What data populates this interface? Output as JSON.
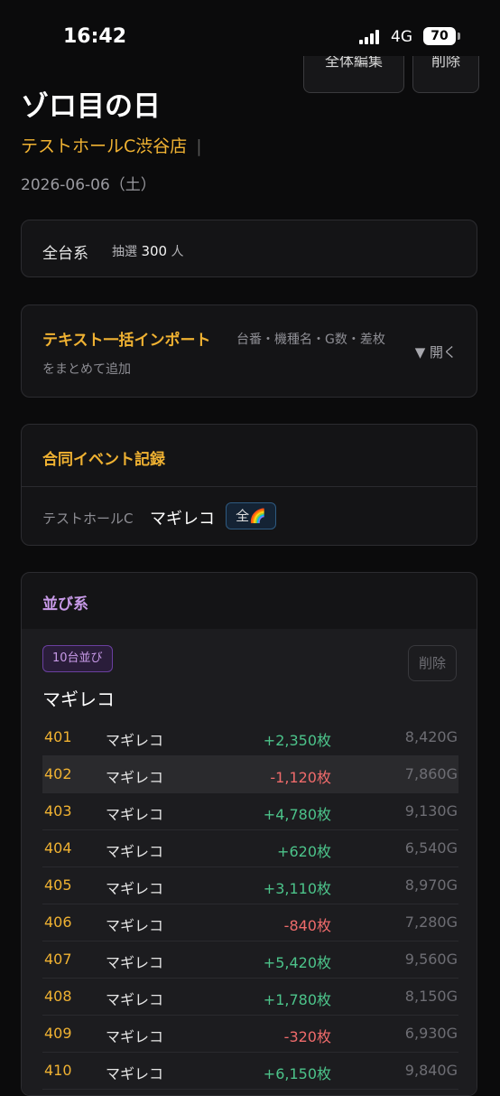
{
  "status": {
    "time": "16:42",
    "network": "4G",
    "battery": "70"
  },
  "top_actions": {
    "edit_label": "全体編集",
    "delete_label": "削除"
  },
  "event": {
    "title": "ゾロ目の日",
    "store": "テストホールC渋谷店",
    "separator": "|",
    "date": "2026-06-06（土）"
  },
  "lottery": {
    "type": "全台系",
    "prefix": "抽選",
    "count": "300",
    "unit": "人"
  },
  "import": {
    "title": "テキスト一括インポート",
    "desc1": "台番・機種名・G数・差枚",
    "desc2": "をまとめて追加",
    "toggle": "▼ 開く"
  },
  "joint": {
    "title": "合同イベント記録",
    "store": "テストホールC",
    "machine": "マギレコ",
    "badge": "全🌈"
  },
  "row_section": {
    "title": "並び系",
    "group": {
      "tag": "10台並び",
      "delete_label": "削除",
      "machine": "マギレコ",
      "rows": [
        {
          "num": "401",
          "machine": "マギレコ",
          "diff": "+2,350枚",
          "games": "8,420G",
          "sign": "pos"
        },
        {
          "num": "402",
          "machine": "マギレコ",
          "diff": "-1,120枚",
          "games": "7,860G",
          "sign": "neg"
        },
        {
          "num": "403",
          "machine": "マギレコ",
          "diff": "+4,780枚",
          "games": "9,130G",
          "sign": "pos"
        },
        {
          "num": "404",
          "machine": "マギレコ",
          "diff": "+620枚",
          "games": "6,540G",
          "sign": "pos"
        },
        {
          "num": "405",
          "machine": "マギレコ",
          "diff": "+3,110枚",
          "games": "8,970G",
          "sign": "pos"
        },
        {
          "num": "406",
          "machine": "マギレコ",
          "diff": "-840枚",
          "games": "7,280G",
          "sign": "neg"
        },
        {
          "num": "407",
          "machine": "マギレコ",
          "diff": "+5,420枚",
          "games": "9,560G",
          "sign": "pos"
        },
        {
          "num": "408",
          "machine": "マギレコ",
          "diff": "+1,780枚",
          "games": "8,150G",
          "sign": "pos"
        },
        {
          "num": "409",
          "machine": "マギレコ",
          "diff": "-320枚",
          "games": "6,930G",
          "sign": "neg"
        },
        {
          "num": "410",
          "machine": "マギレコ",
          "diff": "+6,150枚",
          "games": "9,840G",
          "sign": "pos"
        }
      ]
    }
  }
}
